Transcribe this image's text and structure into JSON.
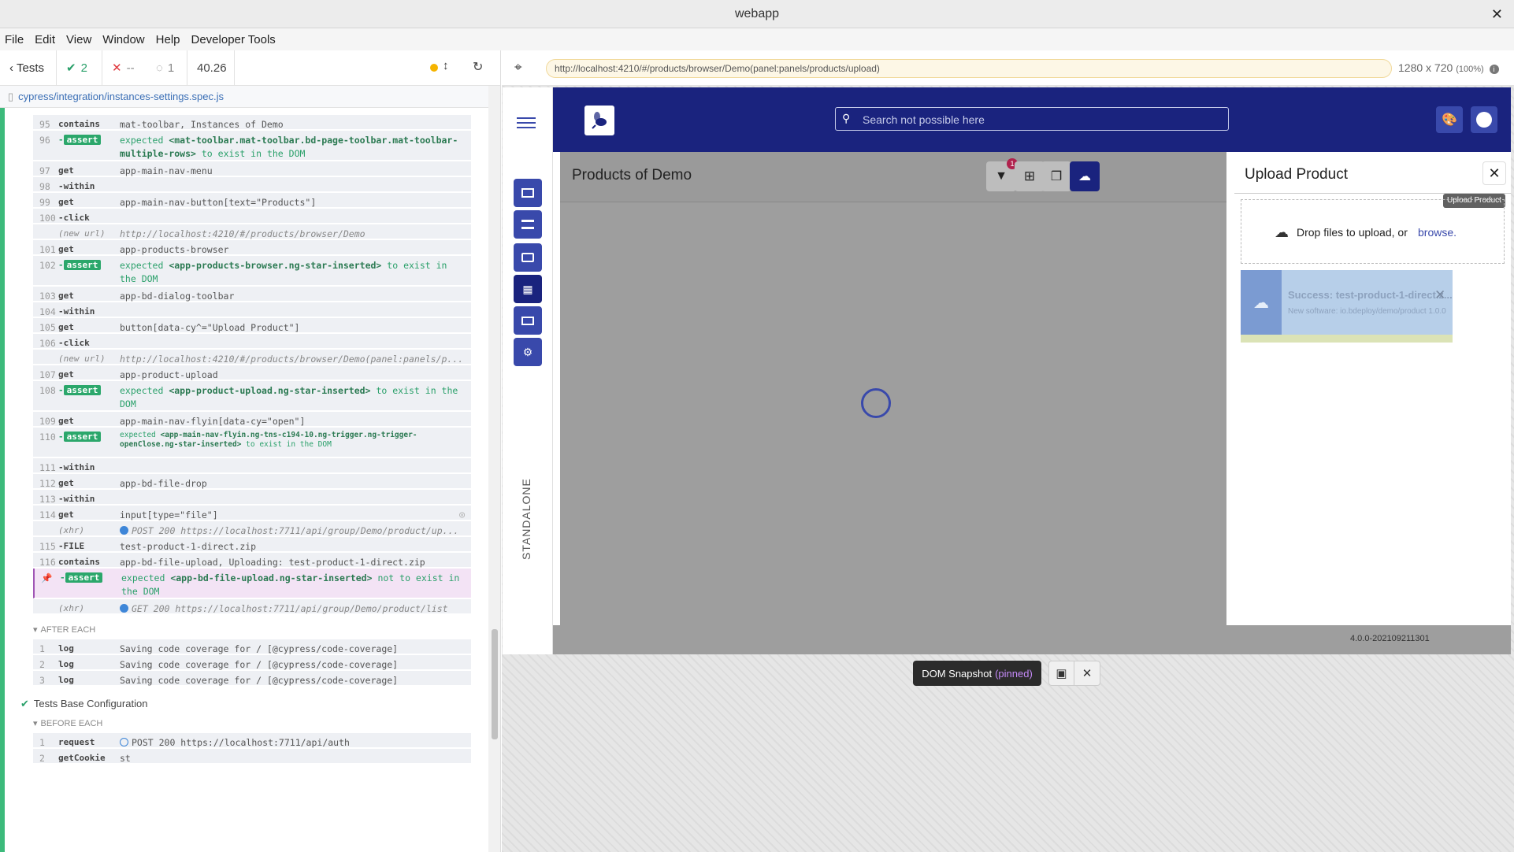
{
  "window": {
    "title": "webapp"
  },
  "menu": [
    "File",
    "Edit",
    "View",
    "Window",
    "Help",
    "Developer Tools"
  ],
  "runner": {
    "tests_label": "Tests",
    "passed": "2",
    "failed": "--",
    "pending": "1",
    "duration": "40.26",
    "spec_path": "cypress/integration/instances-settings.spec.js"
  },
  "commands": [
    {
      "num": "95",
      "name": "contains",
      "msg": "mat-toolbar, Instances of Demo"
    },
    {
      "num": "96",
      "name": "-assert",
      "pre": "expected",
      "el": "<mat-toolbar.mat-toolbar.bd-page-toolbar.mat-toolbar-multiple-rows>",
      "post": "to exist in the DOM"
    },
    {
      "num": "97",
      "name": "get",
      "msg": "app-main-nav-menu"
    },
    {
      "num": "98",
      "name": "-within",
      "msg": ""
    },
    {
      "num": "99",
      "name": "get",
      "msg": "app-main-nav-button[text=\"Products\"]"
    },
    {
      "num": "100",
      "name": "-click",
      "msg": ""
    },
    {
      "num": "",
      "name": "(new url)",
      "msg": "http://localhost:4210/#/products/browser/Demo"
    },
    {
      "num": "101",
      "name": "get",
      "msg": "app-products-browser"
    },
    {
      "num": "102",
      "name": "-assert",
      "pre": "expected",
      "el": "<app-products-browser.ng-star-inserted>",
      "post": "to exist in the DOM"
    },
    {
      "num": "103",
      "name": "get",
      "msg": "app-bd-dialog-toolbar"
    },
    {
      "num": "104",
      "name": "-within",
      "msg": ""
    },
    {
      "num": "105",
      "name": "get",
      "msg": "button[data-cy^=\"Upload Product\"]"
    },
    {
      "num": "106",
      "name": "-click",
      "msg": ""
    },
    {
      "num": "",
      "name": "(new url)",
      "msg": "http://localhost:4210/#/products/browser/Demo(panel:panels/p..."
    },
    {
      "num": "107",
      "name": "get",
      "msg": "app-product-upload"
    },
    {
      "num": "108",
      "name": "-assert",
      "pre": "expected",
      "el": "<app-product-upload.ng-star-inserted>",
      "post": "to exist in the DOM"
    },
    {
      "num": "109",
      "name": "get",
      "msg": "app-main-nav-flyin[data-cy=\"open\"]"
    },
    {
      "num": "110",
      "name": "-assert",
      "pre": "expected",
      "el": "<app-main-nav-flyin.ng-tns-c194-10.ng-trigger.ng-trigger-openClose.ng-star-inserted>",
      "post": "to exist in the DOM"
    },
    {
      "num": "111",
      "name": "-within",
      "msg": ""
    },
    {
      "num": "112",
      "name": "get",
      "msg": "app-bd-file-drop"
    },
    {
      "num": "113",
      "name": "-within",
      "msg": ""
    },
    {
      "num": "114",
      "name": "get",
      "msg": "input[type=\"file\"]"
    },
    {
      "num": "",
      "name": "(xhr)",
      "msg": "POST 200 https://localhost:7711/api/group/Demo/product/up..."
    },
    {
      "num": "115",
      "name": "-FILE",
      "msg": "test-product-1-direct.zip"
    },
    {
      "num": "116",
      "name": "contains",
      "msg": "app-bd-file-upload, Uploading: test-product-1-direct.zip"
    },
    {
      "num": "",
      "name": "-assert",
      "pre": "expected",
      "el": "<app-bd-file-upload.ng-star-inserted>",
      "post": "not to exist in the DOM"
    },
    {
      "num": "",
      "name": "(xhr)",
      "msg": "GET 200 https://localhost:7711/api/group/Demo/product/list"
    }
  ],
  "after_each": {
    "header": "AFTER EACH",
    "rows": [
      {
        "num": "1",
        "name": "log",
        "msg": "Saving code coverage for / [@cypress/code-coverage]"
      },
      {
        "num": "2",
        "name": "log",
        "msg": "Saving code coverage for / [@cypress/code-coverage]"
      },
      {
        "num": "3",
        "name": "log",
        "msg": "Saving code coverage for / [@cypress/code-coverage]"
      }
    ]
  },
  "next_test": {
    "title": "Tests Base Configuration",
    "before_each": "BEFORE EACH",
    "rows": [
      {
        "num": "1",
        "name": "request",
        "msg": "POST 200 https://localhost:7711/api/auth"
      },
      {
        "num": "2",
        "name": "getCookie",
        "msg": "st"
      }
    ]
  },
  "aut": {
    "url": "http://localhost:4210/#/products/browser/Demo(panel:panels/products/upload)",
    "viewport": "1280 x 720",
    "zoom": "(100%)"
  },
  "app": {
    "search_placeholder": "Search not possible here",
    "page_title": "Products of Demo",
    "filter_badge": "1",
    "sidenav_label": "STANDALONE",
    "flyin_title": "Upload Product",
    "tooltip": "Upload Product",
    "drop_text": "Drop files to upload, or",
    "browse": "browse.",
    "success_title": "Success: test-product-1-direct.z...",
    "success_sub": "New software: io.bdeploy/demo/product 1.0.0",
    "version": "4.0.0-202109211301"
  },
  "snapshot": {
    "label": "DOM Snapshot",
    "pinned": "(pinned)"
  },
  "colors": {
    "header": "#1a237e",
    "nav_button": "#3949ab",
    "pass": "#2ba76b",
    "pinned_row": "#f3e3f5"
  }
}
